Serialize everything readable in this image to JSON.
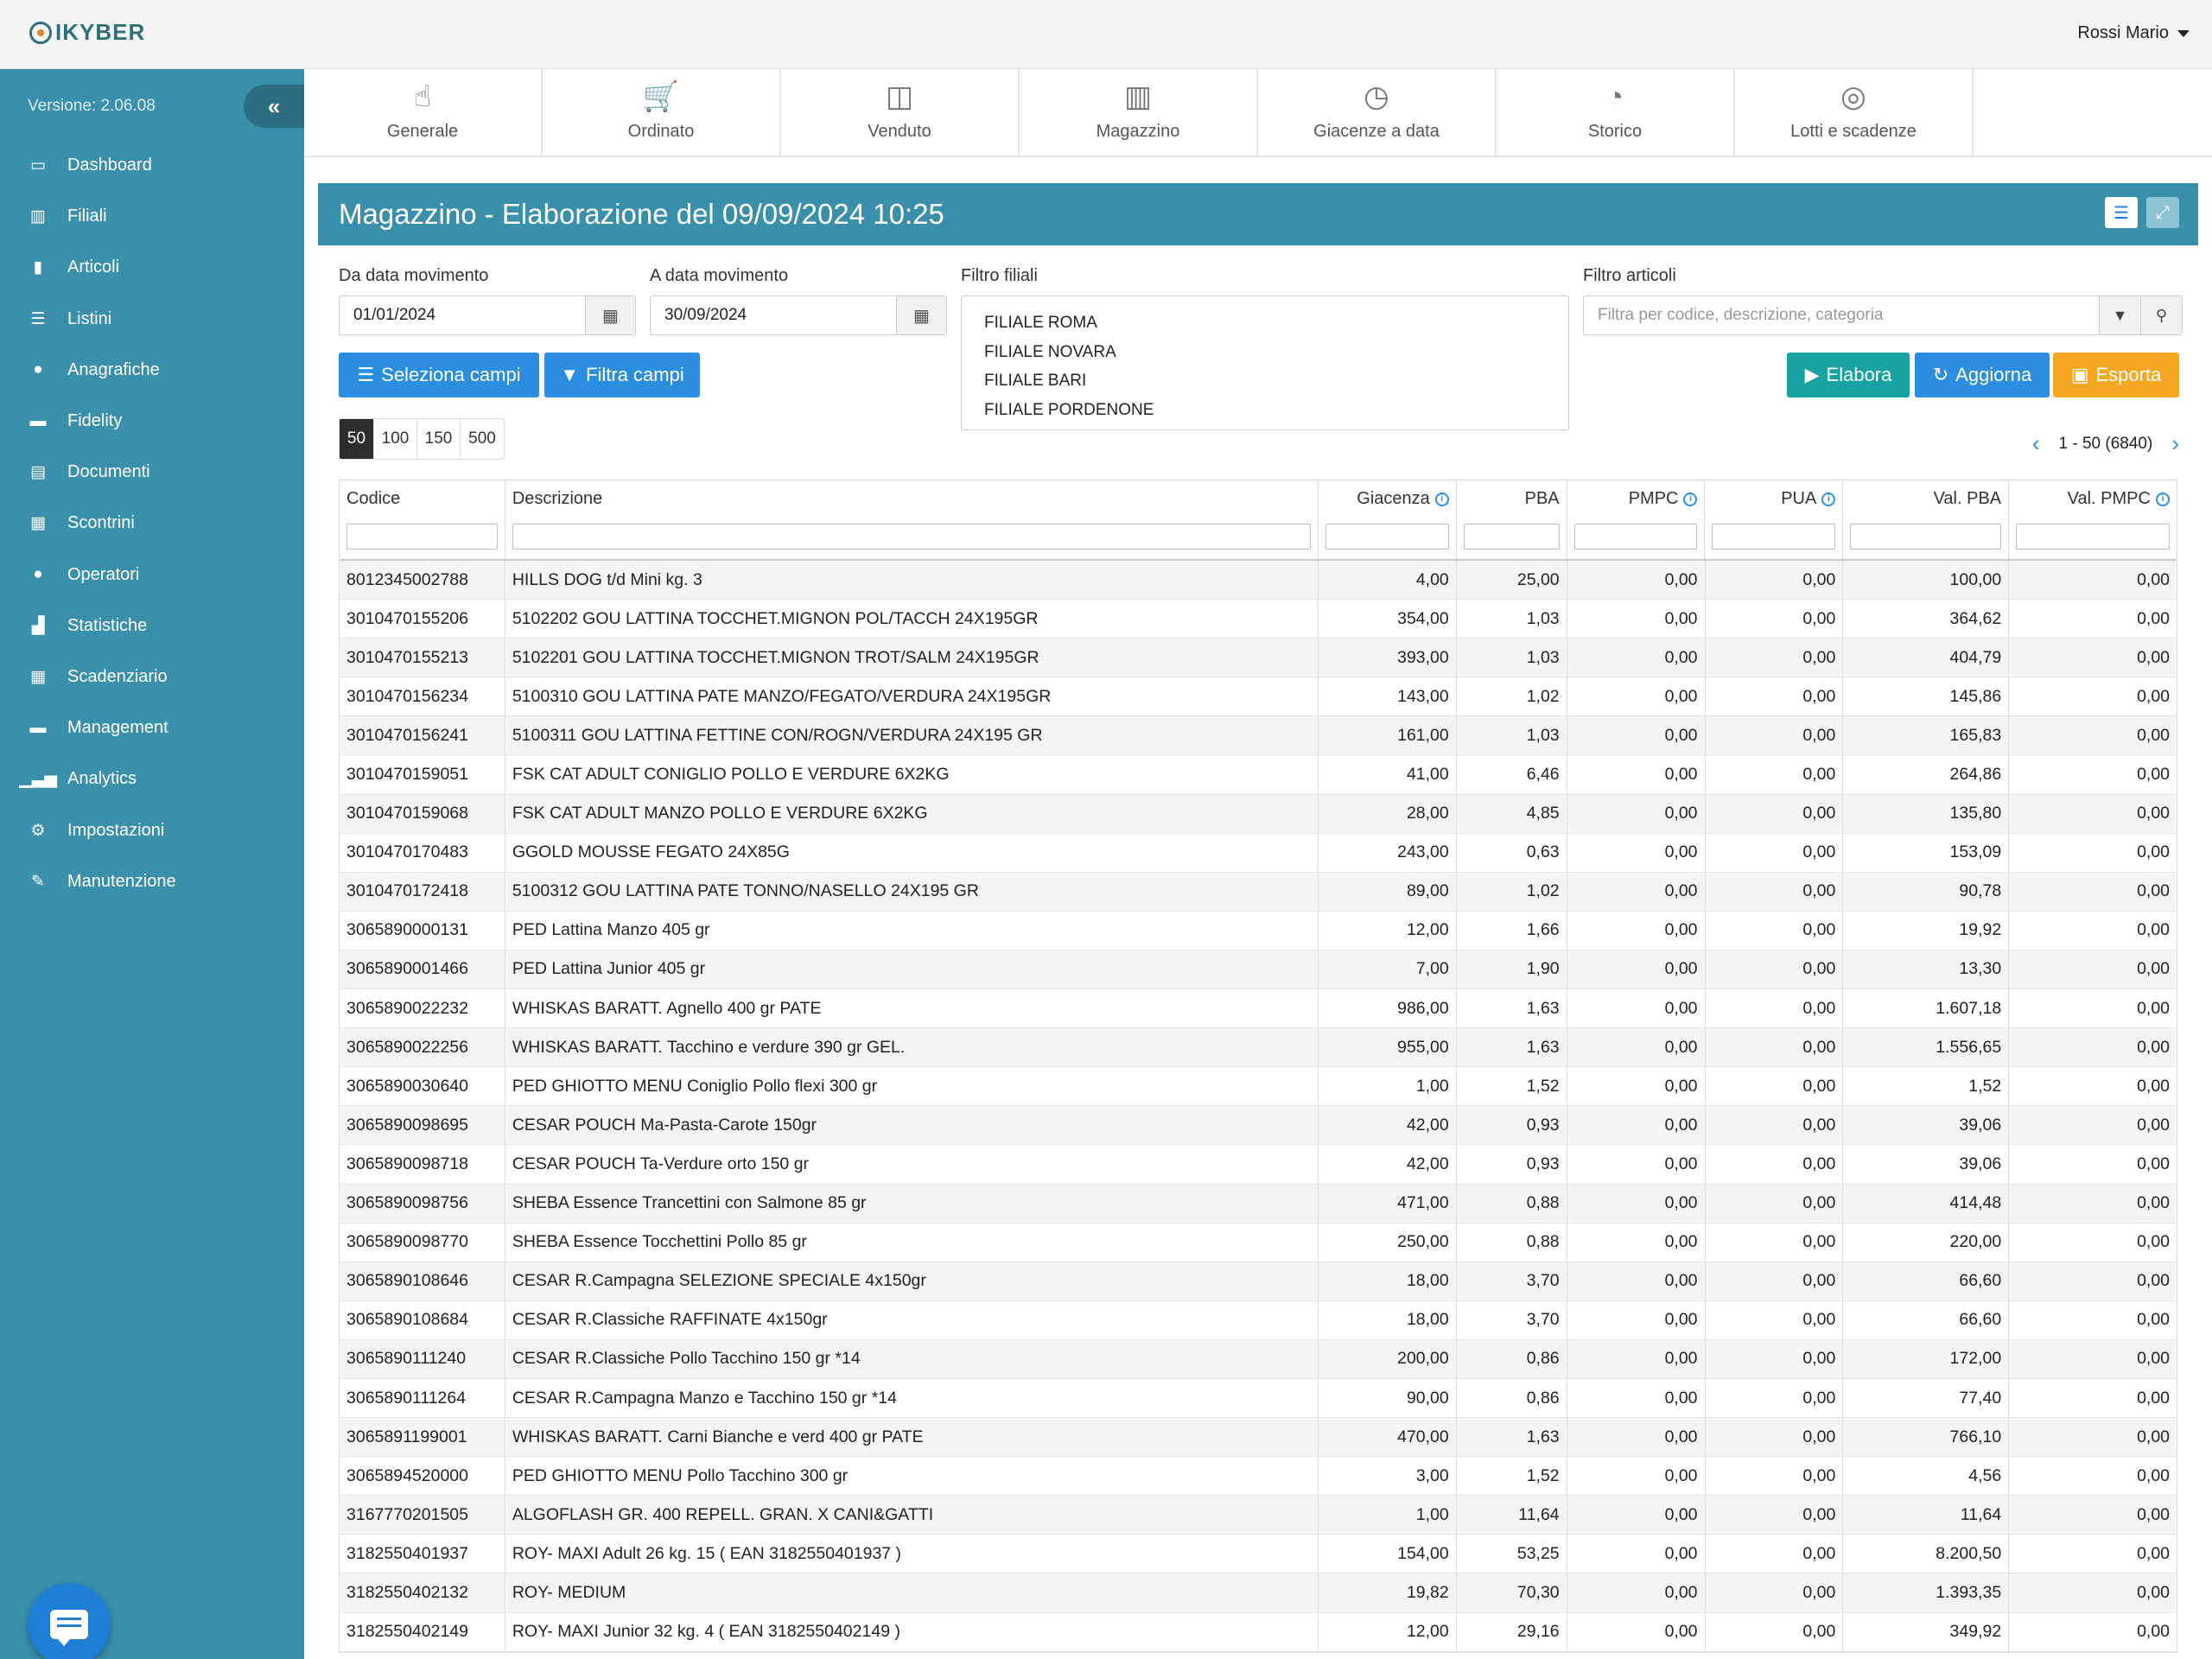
{
  "app": {
    "logo_text": "IKYBER",
    "user_name": "Rossi Mario"
  },
  "sidebar": {
    "version": "Versione: 2.06.08",
    "items": [
      {
        "label": "Dashboard",
        "icon": "laptop-icon"
      },
      {
        "label": "Filiali",
        "icon": "building-icon"
      },
      {
        "label": "Articoli",
        "icon": "barcode-icon"
      },
      {
        "label": "Listini",
        "icon": "list-icon"
      },
      {
        "label": "Anagrafiche",
        "icon": "users-icon"
      },
      {
        "label": "Fidelity",
        "icon": "card-icon"
      },
      {
        "label": "Documenti",
        "icon": "document-icon"
      },
      {
        "label": "Scontrini",
        "icon": "receipt-icon"
      },
      {
        "label": "Operatori",
        "icon": "user-icon"
      },
      {
        "label": "Statistiche",
        "icon": "bar-chart-icon"
      },
      {
        "label": "Scadenziario",
        "icon": "calendar-icon"
      },
      {
        "label": "Management",
        "icon": "briefcase-icon"
      },
      {
        "label": "Analytics",
        "icon": "signal-icon"
      },
      {
        "label": "Impostazioni",
        "icon": "gears-icon"
      },
      {
        "label": "Manutenzione",
        "icon": "wrench-icon"
      }
    ]
  },
  "tabs": [
    {
      "label": "Generale",
      "icon": "hand-pointer-icon"
    },
    {
      "label": "Ordinato",
      "icon": "cart-icon"
    },
    {
      "label": "Venduto",
      "icon": "shopping-bag-icon"
    },
    {
      "label": "Magazzino",
      "icon": "warehouse-icon"
    },
    {
      "label": "Giacenze a data",
      "icon": "calendar-clock-icon"
    },
    {
      "label": "Storico",
      "icon": "history-icon"
    },
    {
      "label": "Lotti e scadenze",
      "icon": "lots-icon"
    }
  ],
  "panel": {
    "title": "Magazzino - Elaborazione del 09/09/2024 10:25"
  },
  "filters": {
    "from_label": "Da data movimento",
    "from_value": "01/01/2024",
    "to_label": "A data movimento",
    "to_value": "30/09/2024",
    "filiali_label": "Filtro filiali",
    "filiali": [
      "FILIALE ROMA",
      "FILIALE NOVARA",
      "FILIALE BARI",
      "FILIALE PORDENONE"
    ],
    "articoli_label": "Filtro articoli",
    "articoli_placeholder": "Filtra per codice, descrizione, categoria"
  },
  "buttons": {
    "seleziona": "Seleziona campi",
    "filtra": "Filtra campi",
    "elabora": "Elabora",
    "aggiorna": "Aggiorna",
    "esporta": "Esporta"
  },
  "pagination": {
    "sizes": [
      "50",
      "100",
      "150",
      "500"
    ],
    "active_size": "50",
    "range": "1 - 50 (6840)"
  },
  "table": {
    "headers": [
      "Codice",
      "Descrizione",
      "Giacenza",
      "PBA",
      "PMPC",
      "PUA",
      "Val. PBA",
      "Val. PMPC"
    ],
    "rows": [
      [
        "8012345002788",
        "HILLS DOG t/d Mini kg. 3",
        "4,00",
        "25,00",
        "0,00",
        "0,00",
        "100,00",
        "0,00"
      ],
      [
        "3010470155206",
        "5102202 GOU LATTINA TOCCHET.MIGNON POL/TACCH 24X195GR",
        "354,00",
        "1,03",
        "0,00",
        "0,00",
        "364,62",
        "0,00"
      ],
      [
        "3010470155213",
        "5102201 GOU LATTINA TOCCHET.MIGNON TROT/SALM 24X195GR",
        "393,00",
        "1,03",
        "0,00",
        "0,00",
        "404,79",
        "0,00"
      ],
      [
        "3010470156234",
        "5100310 GOU LATTINA PATE MANZO/FEGATO/VERDURA 24X195GR",
        "143,00",
        "1,02",
        "0,00",
        "0,00",
        "145,86",
        "0,00"
      ],
      [
        "3010470156241",
        "5100311 GOU LATTINA FETTINE CON/ROGN/VERDURA 24X195 GR",
        "161,00",
        "1,03",
        "0,00",
        "0,00",
        "165,83",
        "0,00"
      ],
      [
        "3010470159051",
        "FSK CAT ADULT CONIGLIO POLLO E VERDURE 6X2KG",
        "41,00",
        "6,46",
        "0,00",
        "0,00",
        "264,86",
        "0,00"
      ],
      [
        "3010470159068",
        "FSK CAT ADULT MANZO POLLO E VERDURE 6X2KG",
        "28,00",
        "4,85",
        "0,00",
        "0,00",
        "135,80",
        "0,00"
      ],
      [
        "3010470170483",
        "GGOLD MOUSSE FEGATO 24X85G",
        "243,00",
        "0,63",
        "0,00",
        "0,00",
        "153,09",
        "0,00"
      ],
      [
        "3010470172418",
        "5100312 GOU LATTINA PATE TONNO/NASELLO 24X195 GR",
        "89,00",
        "1,02",
        "0,00",
        "0,00",
        "90,78",
        "0,00"
      ],
      [
        "3065890000131",
        "PED Lattina Manzo 405 gr",
        "12,00",
        "1,66",
        "0,00",
        "0,00",
        "19,92",
        "0,00"
      ],
      [
        "3065890001466",
        "PED Lattina Junior 405 gr",
        "7,00",
        "1,90",
        "0,00",
        "0,00",
        "13,30",
        "0,00"
      ],
      [
        "3065890022232",
        "WHISKAS BARATT. Agnello 400 gr PATE",
        "986,00",
        "1,63",
        "0,00",
        "0,00",
        "1.607,18",
        "0,00"
      ],
      [
        "3065890022256",
        "WHISKAS BARATT. Tacchino e verdure 390 gr GEL.",
        "955,00",
        "1,63",
        "0,00",
        "0,00",
        "1.556,65",
        "0,00"
      ],
      [
        "3065890030640",
        "PED GHIOTTO MENU Coniglio Pollo flexi 300 gr",
        "1,00",
        "1,52",
        "0,00",
        "0,00",
        "1,52",
        "0,00"
      ],
      [
        "3065890098695",
        "CESAR POUCH Ma-Pasta-Carote 150gr",
        "42,00",
        "0,93",
        "0,00",
        "0,00",
        "39,06",
        "0,00"
      ],
      [
        "3065890098718",
        "CESAR POUCH Ta-Verdure orto 150 gr",
        "42,00",
        "0,93",
        "0,00",
        "0,00",
        "39,06",
        "0,00"
      ],
      [
        "3065890098756",
        "SHEBA Essence Trancettini con Salmone 85 gr",
        "471,00",
        "0,88",
        "0,00",
        "0,00",
        "414,48",
        "0,00"
      ],
      [
        "3065890098770",
        "SHEBA Essence Tocchettini Pollo 85 gr",
        "250,00",
        "0,88",
        "0,00",
        "0,00",
        "220,00",
        "0,00"
      ],
      [
        "3065890108646",
        "CESAR R.Campagna SELEZIONE SPECIALE 4x150gr",
        "18,00",
        "3,70",
        "0,00",
        "0,00",
        "66,60",
        "0,00"
      ],
      [
        "3065890108684",
        "CESAR R.Classiche RAFFINATE 4x150gr",
        "18,00",
        "3,70",
        "0,00",
        "0,00",
        "66,60",
        "0,00"
      ],
      [
        "3065890111240",
        "CESAR R.Classiche Pollo Tacchino 150 gr *14",
        "200,00",
        "0,86",
        "0,00",
        "0,00",
        "172,00",
        "0,00"
      ],
      [
        "3065890111264",
        "CESAR R.Campagna Manzo e Tacchino 150 gr *14",
        "90,00",
        "0,86",
        "0,00",
        "0,00",
        "77,40",
        "0,00"
      ],
      [
        "3065891199001",
        "WHISKAS BARATT. Carni Bianche e verd 400 gr PATE",
        "470,00",
        "1,63",
        "0,00",
        "0,00",
        "766,10",
        "0,00"
      ],
      [
        "3065894520000",
        "PED GHIOTTO MENU Pollo Tacchino 300 gr",
        "3,00",
        "1,52",
        "0,00",
        "0,00",
        "4,56",
        "0,00"
      ],
      [
        "3167770201505",
        "ALGOFLASH GR. 400 REPELL. GRAN. X CANI&GATTI",
        "1,00",
        "11,64",
        "0,00",
        "0,00",
        "11,64",
        "0,00"
      ],
      [
        "3182550401937",
        "ROY- MAXI Adult 26 kg. 15 ( EAN 3182550401937 )",
        "154,00",
        "53,25",
        "0,00",
        "0,00",
        "8.200,50",
        "0,00"
      ],
      [
        "3182550402132",
        "ROY- MEDIUM",
        "19,82",
        "70,30",
        "0,00",
        "0,00",
        "1.393,35",
        "0,00"
      ],
      [
        "3182550402149",
        "ROY- MAXI Junior 32 kg. 4 ( EAN 3182550402149 )",
        "12,00",
        "29,16",
        "0,00",
        "0,00",
        "349,92",
        "0,00"
      ]
    ]
  }
}
